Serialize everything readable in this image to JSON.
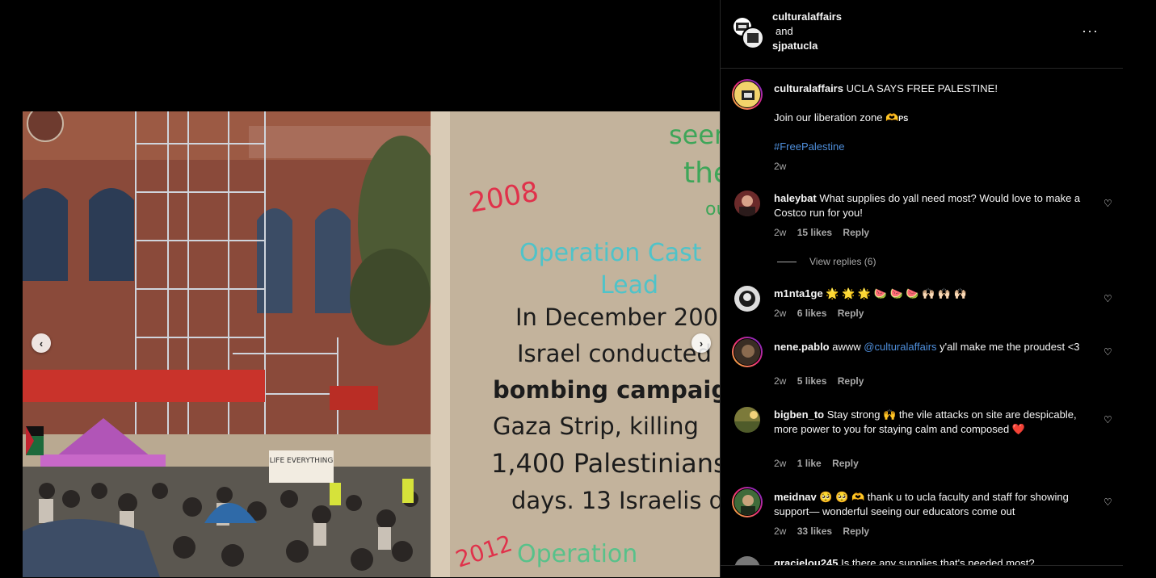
{
  "post": {
    "authors": [
      "culturalaffairs",
      "sjpatucla"
    ],
    "and_label": "and",
    "more_icon": "more-horizontal-icon",
    "more_label": "···"
  },
  "caption": {
    "username": "culturalaffairs",
    "line1": "UCLA SAYS FREE PALESTINE!",
    "line2": "Join our liberation zone",
    "line2_emoji": "🫶",
    "line2_badge": "PS",
    "hashtag": "#FreePalestine",
    "time": "2w"
  },
  "comments": [
    {
      "username": "haleybat",
      "text": "What supplies do yall need most? Would love to make a Costco run for you!",
      "time": "2w",
      "likes": "15 likes",
      "reply": "Reply",
      "view_replies": "View replies (6)"
    },
    {
      "username": "m1nta1ge",
      "text": "🌟 🌟 🌟 🍉 🍉 🍉 🙌🏻 🙌🏻 🙌🏻",
      "time": "2w",
      "likes": "6 likes",
      "reply": "Reply"
    },
    {
      "username": "nene.pablo",
      "text_before": "awww ",
      "mention": "@culturalaffairs",
      "text_after": " y'all make me the proudest <3",
      "time": "2w",
      "likes": "5 likes",
      "reply": "Reply"
    },
    {
      "username": "bigben_to",
      "text": "Stay strong 🙌 the vile attacks on site are despicable, more power to you for staying calm and composed ❤️",
      "time": "2w",
      "likes": "1 like",
      "reply": "Reply"
    },
    {
      "username": "meidnav",
      "text": "🥺 🥺 🫶 thank u to ucla faculty and staff for showing support— wonderful seeing our educators come out",
      "time": "2w",
      "likes": "33 likes",
      "reply": "Reply"
    },
    {
      "username": "gracielou245",
      "text": "Is there any supplies that's needed most?"
    }
  ],
  "heart_icon": "♡",
  "carousel": {
    "prev": "‹",
    "next": "›"
  },
  "photo": {
    "sign_texts": [
      "2008",
      "Operation Cast",
      "Lead",
      "In December 200",
      "Israel conducted",
      "bombing campaig",
      "Gaza Strip, killing",
      "1,400 Palestinians",
      "days. 13 Israelis d",
      "2012",
      "Operation",
      "seen",
      "the",
      "ou"
    ],
    "banner_text": "LIFE EVERYTHING"
  },
  "colors": {
    "accent_link": "#4f8fdc",
    "muted": "#a8a8a8"
  }
}
